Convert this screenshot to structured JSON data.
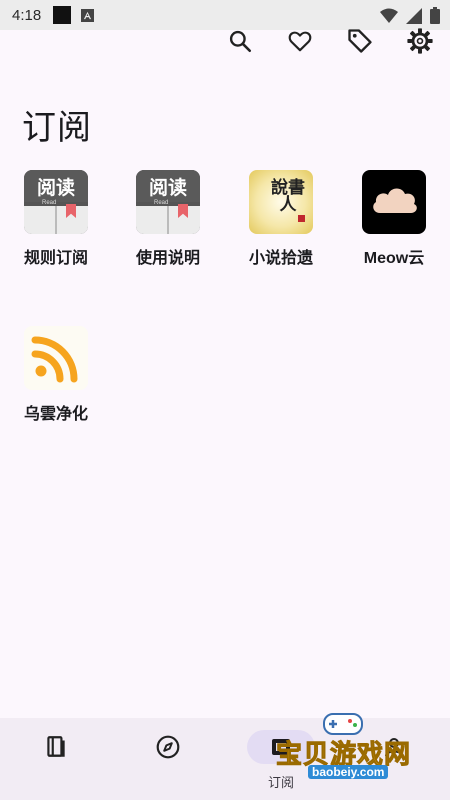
{
  "status_bar": {
    "time": "4:18",
    "icons": [
      "notification-square-icon",
      "android-a-icon",
      "wifi-icon",
      "cell-signal-icon",
      "battery-icon"
    ]
  },
  "toolbar": {
    "icons": [
      "search-icon",
      "heart-icon",
      "tag-icon",
      "settings-gear-icon"
    ]
  },
  "page": {
    "title": "订阅"
  },
  "sources": [
    {
      "label": "规则订阅",
      "icon": "book-read-icon",
      "book_title": "阅读",
      "book_sub": "Read"
    },
    {
      "label": "使用说明",
      "icon": "book-read-icon",
      "book_title": "阅读",
      "book_sub": "Read"
    },
    {
      "label": "小说拾遗",
      "icon": "calligraphy-novel-icon",
      "calligraphy": "說書人"
    },
    {
      "label": "Meow云",
      "icon": "cloud-icon"
    },
    {
      "label": "乌雲净化",
      "icon": "rss-feed-icon"
    }
  ],
  "bottom_nav": {
    "items": [
      {
        "label": "",
        "icon": "bookshelf-icon"
      },
      {
        "label": "",
        "icon": "compass-explore-icon"
      },
      {
        "label": "订阅",
        "icon": "subscription-icon",
        "active": true
      },
      {
        "label": "",
        "icon": "profile-icon"
      }
    ]
  },
  "watermark": {
    "text": "宝贝游戏网",
    "url": "baobeiy.com"
  },
  "colors": {
    "background": "#fcf7fd",
    "nav_background": "#f2ecf4",
    "active_pill": "#e3dcf3",
    "rss_orange": "#f6a41e",
    "bookmark_red": "#e8646a"
  }
}
